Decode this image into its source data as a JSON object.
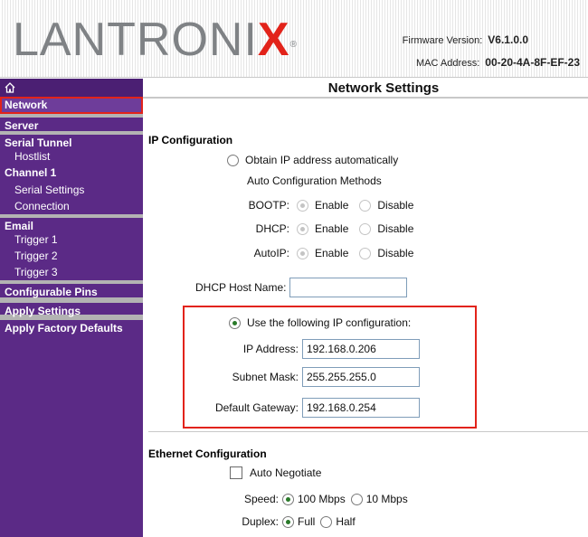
{
  "header": {
    "logo_text": "LANTRONIX",
    "logo_mark": "®",
    "firmware_label": "Firmware Version:",
    "firmware_value": "V6.1.0.0",
    "mac_label": "MAC Address:",
    "mac_value": "00-20-4A-8F-EF-23"
  },
  "sidebar": {
    "home_icon": "home-icon",
    "items": [
      {
        "label": "Network"
      },
      {
        "label": "Server"
      },
      {
        "label": "Serial Tunnel"
      },
      {
        "label": "Hostlist"
      },
      {
        "label": "Channel 1"
      },
      {
        "label": "Serial Settings"
      },
      {
        "label": "Connection"
      },
      {
        "label": "Email"
      },
      {
        "label": "Trigger 1"
      },
      {
        "label": "Trigger 2"
      },
      {
        "label": "Trigger 3"
      },
      {
        "label": "Configurable Pins"
      },
      {
        "label": "Apply Settings"
      },
      {
        "label": "Apply Factory Defaults"
      }
    ]
  },
  "main": {
    "title": "Network Settings",
    "ip_config": {
      "section_label": "IP Configuration",
      "obtain_auto": "Obtain IP address automatically",
      "auto_methods": "Auto Configuration Methods",
      "bootp_label": "BOOTP:",
      "dhcp_label": "DHCP:",
      "autoip_label": "AutoIP:",
      "enable": "Enable",
      "disable": "Disable",
      "dhcp_host_label": "DHCP Host Name:",
      "dhcp_host_value": "",
      "use_following": "Use the following IP configuration:",
      "ip_label": "IP Address:",
      "ip_value": "192.168.0.206",
      "subnet_label": "Subnet Mask:",
      "subnet_value": "255.255.255.0",
      "gateway_label": "Default Gateway:",
      "gateway_value": "192.168.0.254"
    },
    "ethernet": {
      "section_label": "Ethernet Configuration",
      "auto_negotiate": "Auto Negotiate",
      "speed_label": "Speed:",
      "speed_100": "100 Mbps",
      "speed_10": "10 Mbps",
      "duplex_label": "Duplex:",
      "duplex_full": "Full",
      "duplex_half": "Half"
    }
  },
  "colors": {
    "sidebar": "#5b2a86",
    "highlight": "#e2231a",
    "logo_gray": "#7f8285"
  }
}
